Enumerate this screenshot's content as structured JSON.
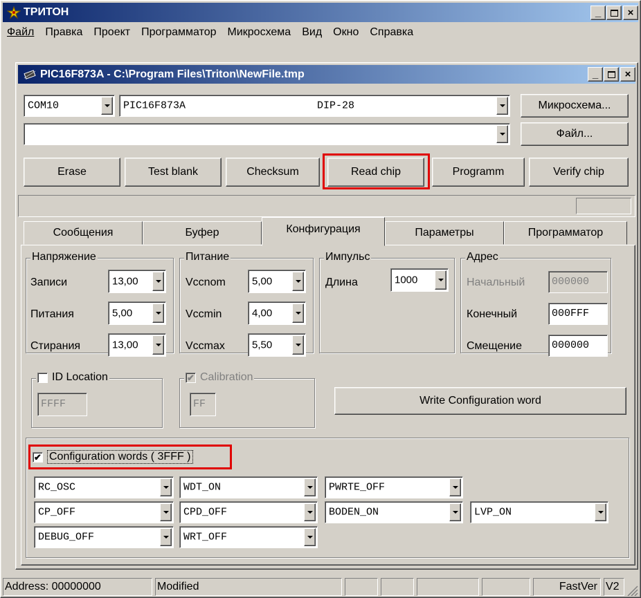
{
  "app": {
    "title": "ТРИТОН",
    "menu": [
      "Файл",
      "Правка",
      "Проект",
      "Программатор",
      "Микросхема",
      "Вид",
      "Окно",
      "Справка"
    ]
  },
  "child": {
    "title": "PIC16F873A - C:\\Program Files\\Triton\\NewFile.tmp",
    "port": "COM10",
    "chip": "PIC16F873A",
    "package": "DIP-28",
    "chip_button": "Микросхема...",
    "file_value": "",
    "file_button": "Файл...",
    "actions": [
      "Erase",
      "Test blank",
      "Checksum",
      "Read chip",
      "Programm",
      "Verify chip"
    ],
    "tabs": [
      "Сообщения",
      "Буфер",
      "Конфигурация",
      "Параметры",
      "Программатор"
    ],
    "active_tab": "Конфигурация"
  },
  "voltage": {
    "title": "Напряжение",
    "rows": [
      {
        "label": "Записи",
        "value": "13,00"
      },
      {
        "label": "Питания",
        "value": "5,00"
      },
      {
        "label": "Стирания",
        "value": "13,00"
      }
    ]
  },
  "power": {
    "title": "Питание",
    "rows": [
      {
        "label": "Vccnom",
        "value": "5,00"
      },
      {
        "label": "Vccmin",
        "value": "4,00"
      },
      {
        "label": "Vccmax",
        "value": "5,50"
      }
    ]
  },
  "pulse": {
    "title": "Импульс",
    "label": "Длина",
    "value": "1000"
  },
  "address": {
    "title": "Адрес",
    "rows": [
      {
        "label": "Начальный",
        "value": "000000"
      },
      {
        "label": "Конечный",
        "value": "000FFF"
      },
      {
        "label": "Смещение",
        "value": "000000"
      }
    ]
  },
  "id_location": {
    "label": "ID Location",
    "checked": false,
    "value": "FFFF"
  },
  "calibration": {
    "label": "Calibration",
    "checked": true,
    "value": "FF"
  },
  "write_config_button": "Write Configuration word",
  "config_words": {
    "label": "Configuration words ( 3FFF )",
    "checked": true,
    "row1": [
      "RC_OSC",
      "WDT_ON",
      "PWRTE_OFF"
    ],
    "row2": [
      "CP_OFF",
      "CPD_OFF",
      "BODEN_ON",
      "LVP_ON"
    ],
    "row3": [
      "DEBUG_OFF",
      "WRT_OFF"
    ]
  },
  "status": {
    "address": "Address: 00000000",
    "state": "Modified",
    "fastver": "FastVer",
    "version": "V2"
  },
  "colors": {
    "title_gradient_start": "#0a246a",
    "title_gradient_end": "#a6caf0",
    "face": "#d4d0c8",
    "highlight": "#e00000"
  }
}
